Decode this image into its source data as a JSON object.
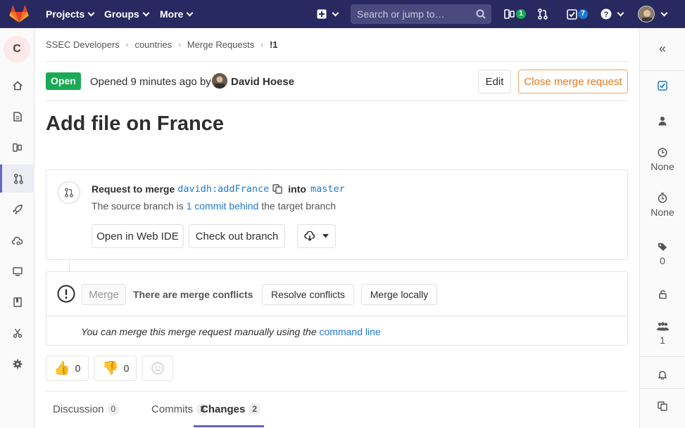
{
  "topnav": {
    "projects": "Projects",
    "groups": "Groups",
    "more": "More",
    "search_placeholder": "Search or jump to…",
    "issues_count": "1",
    "todos_count": "7"
  },
  "sidebar_left": {
    "project_initial": "C"
  },
  "breadcrumb": [
    "SSEC Developers",
    "countries",
    "Merge Requests",
    "!1"
  ],
  "mr": {
    "status": "Open",
    "opened_text": "Opened 9 minutes ago by",
    "author": "David Hoese",
    "edit_label": "Edit",
    "close_label": "Close merge request",
    "title": "Add file on France"
  },
  "widget": {
    "request_label": "Request to merge",
    "source_branch": "davidh:addFrance",
    "into_label": "into",
    "target_branch": "master",
    "behind_pre": "The source branch is",
    "behind_link": "1 commit behind",
    "behind_post": "the target branch",
    "open_web_ide": "Open in Web IDE",
    "checkout_branch": "Check out branch"
  },
  "merge": {
    "merge_label": "Merge",
    "conflicts_text": "There are merge conflicts",
    "resolve_label": "Resolve conflicts",
    "merge_locally_label": "Merge locally",
    "manual_text": "You can merge this merge request manually using the",
    "manual_link": "command line"
  },
  "reactions": {
    "thumbsup": "0",
    "thumbsdown": "0"
  },
  "tabs": [
    {
      "label": "Discussion",
      "count": "0"
    },
    {
      "label": "Commits",
      "count": "3"
    },
    {
      "label": "Changes",
      "count": "2"
    }
  ],
  "sidebar_right": {
    "time_estimate": "None",
    "time_spent": "None",
    "labels_count": "0",
    "participants_count": "1"
  },
  "colors": {
    "nav_bg": "#292961",
    "open_badge": "#1aaa55",
    "link": "#1f78d1",
    "warning": "#e07a1f",
    "active_tab": "#6666c4"
  }
}
